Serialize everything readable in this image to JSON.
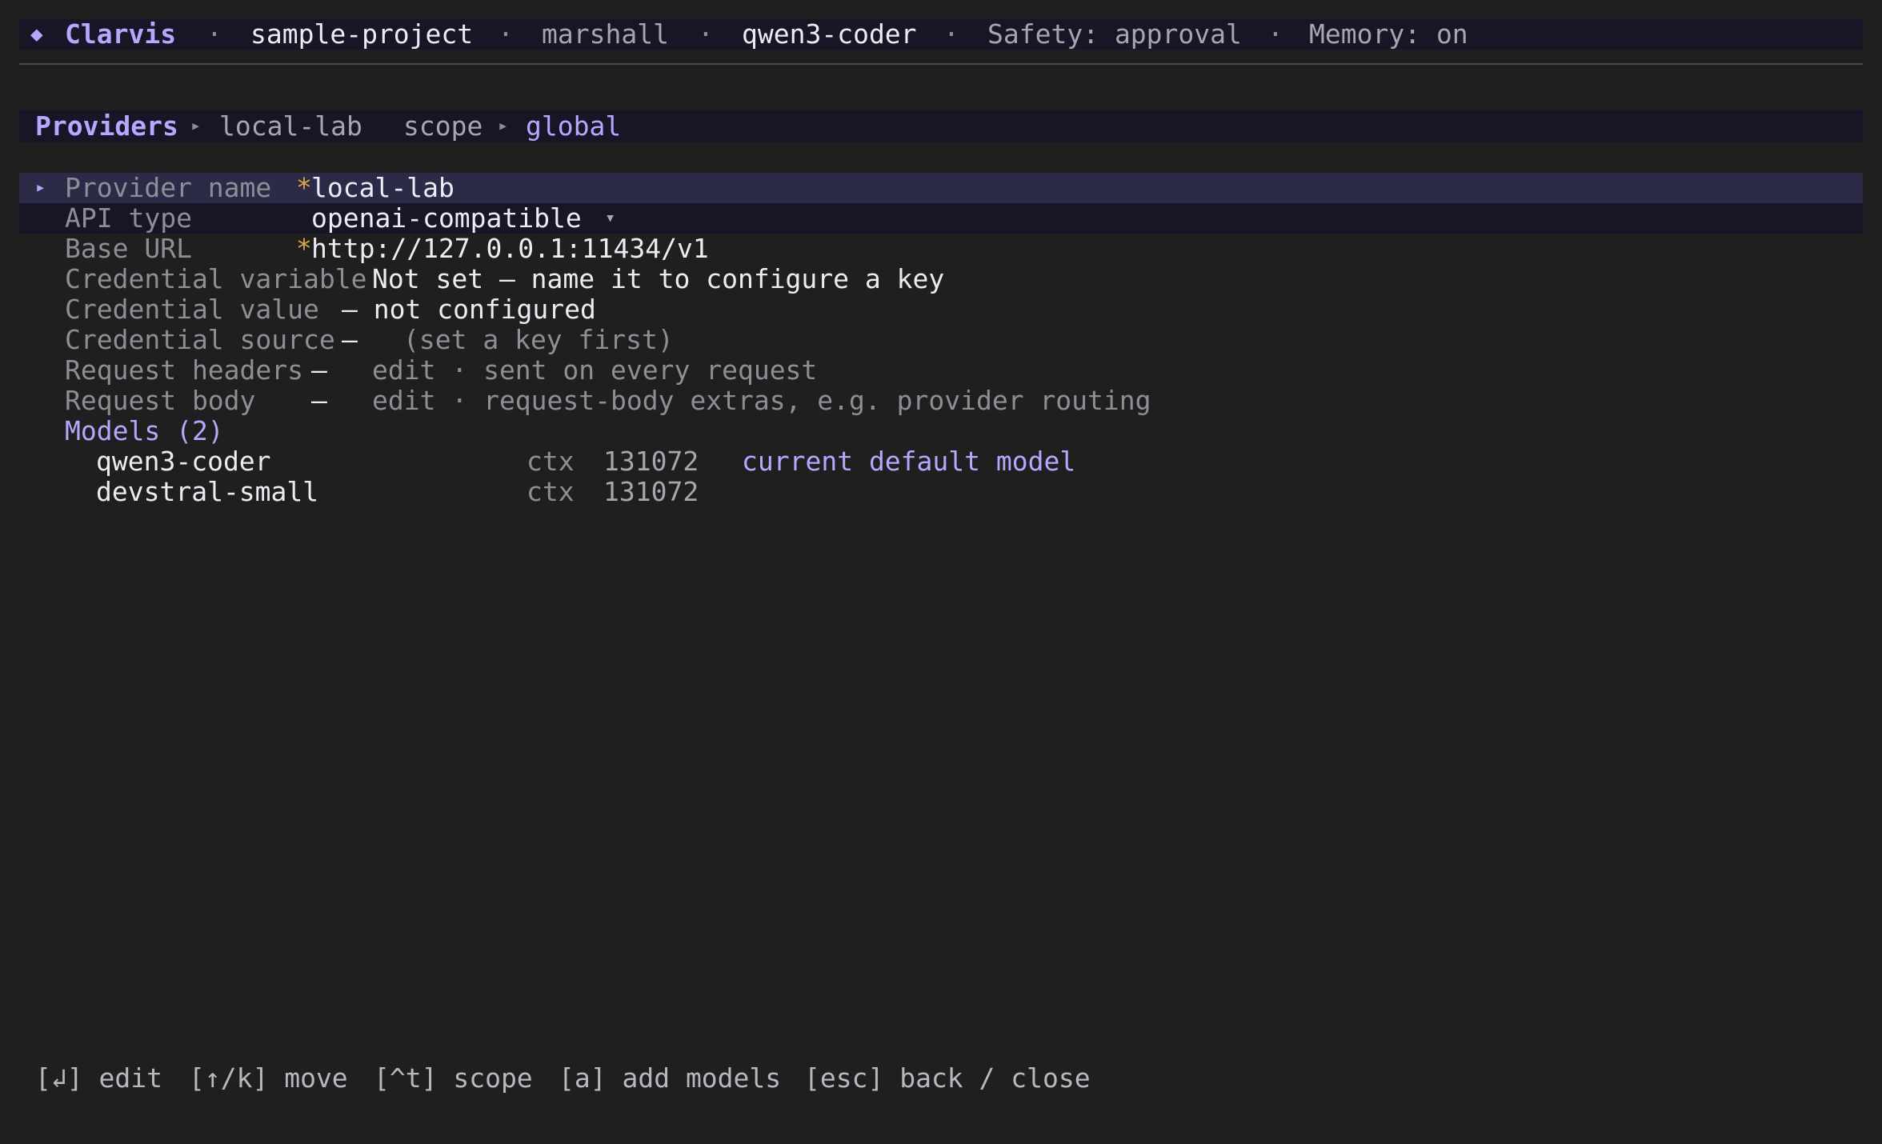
{
  "header": {
    "brand_icon": "◆",
    "brand": "Clarvis",
    "separator": "·",
    "project": "sample-project",
    "user": "marshall",
    "model": "qwen3-coder",
    "safety": "Safety: approval",
    "memory": "Memory: on"
  },
  "breadcrumb": {
    "section": "Providers",
    "arrow": "▸",
    "provider": "local-lab",
    "scope_label": "scope",
    "scope_value": "global"
  },
  "form": {
    "cursor": "▸",
    "required_mark": "*",
    "provider_name": {
      "label": "Provider name",
      "value": "local-lab"
    },
    "api_type": {
      "label": "API type",
      "value": "openai-compatible",
      "caret": "▾"
    },
    "base_url": {
      "label": "Base URL",
      "value": "http://127.0.0.1:11434/v1"
    },
    "credential_variable": {
      "label": "Credential variable",
      "value": "Not set — name it to configure a key"
    },
    "credential_value": {
      "label": "Credential value",
      "value": "— not configured"
    },
    "credential_source": {
      "label": "Credential source",
      "dash": "—",
      "hint": "(set a key first)"
    },
    "request_headers": {
      "label": "Request headers",
      "dash": "—",
      "hint": "edit · sent on every request"
    },
    "request_body": {
      "label": "Request body",
      "dash": "—",
      "hint": "edit · request-body extras, e.g. provider routing"
    }
  },
  "models": {
    "heading": "Models (2)",
    "items": [
      {
        "name": "qwen3-coder",
        "ctx_label": "ctx",
        "ctx": "131072",
        "note": "current default model"
      },
      {
        "name": "devstral-small",
        "ctx_label": "ctx",
        "ctx": "131072",
        "note": ""
      }
    ]
  },
  "footer": {
    "edit": "[↲] edit",
    "move": "[↑/k] move",
    "scope": "[^t] scope",
    "add": "[a] add models",
    "back": "[esc] back / close"
  }
}
